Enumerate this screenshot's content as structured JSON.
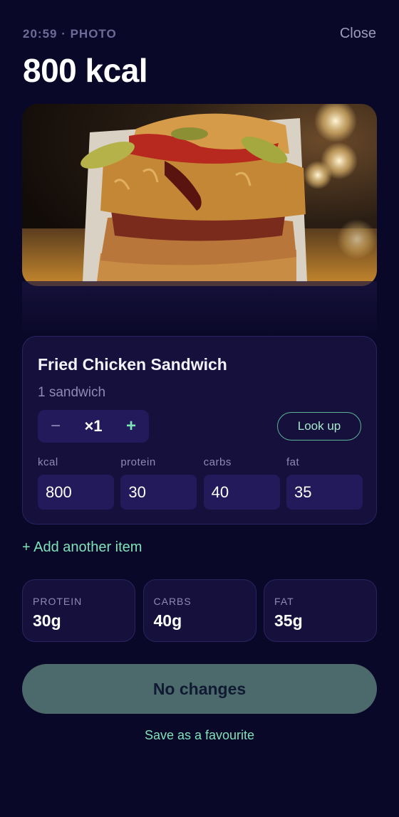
{
  "header": {
    "meta": "20:59 · PHOTO",
    "close_label": "Close",
    "title": "800 kcal"
  },
  "photo": {
    "subject": "fried chicken sandwich photo"
  },
  "item": {
    "name": "Fried Chicken Sandwich",
    "portion": "1 sandwich",
    "quantity": "×1",
    "minus_symbol": "−",
    "plus_symbol": "+",
    "lookup_label": "Look up",
    "macros": [
      {
        "label": "kcal",
        "value": "800"
      },
      {
        "label": "protein",
        "value": "30"
      },
      {
        "label": "carbs",
        "value": "40"
      },
      {
        "label": "fat",
        "value": "35"
      }
    ]
  },
  "add_item_label": "+ Add another item",
  "totals": [
    {
      "label": "PROTEIN",
      "value": "30g"
    },
    {
      "label": "CARBS",
      "value": "40g"
    },
    {
      "label": "FAT",
      "value": "35g"
    }
  ],
  "primary_button": "No changes",
  "favourite_link": "Save as a favourite",
  "colors": {
    "background": "#0a0828",
    "card": "#16113c",
    "accent": "#7ee3b8",
    "primary_button": "#4c6a6b"
  }
}
